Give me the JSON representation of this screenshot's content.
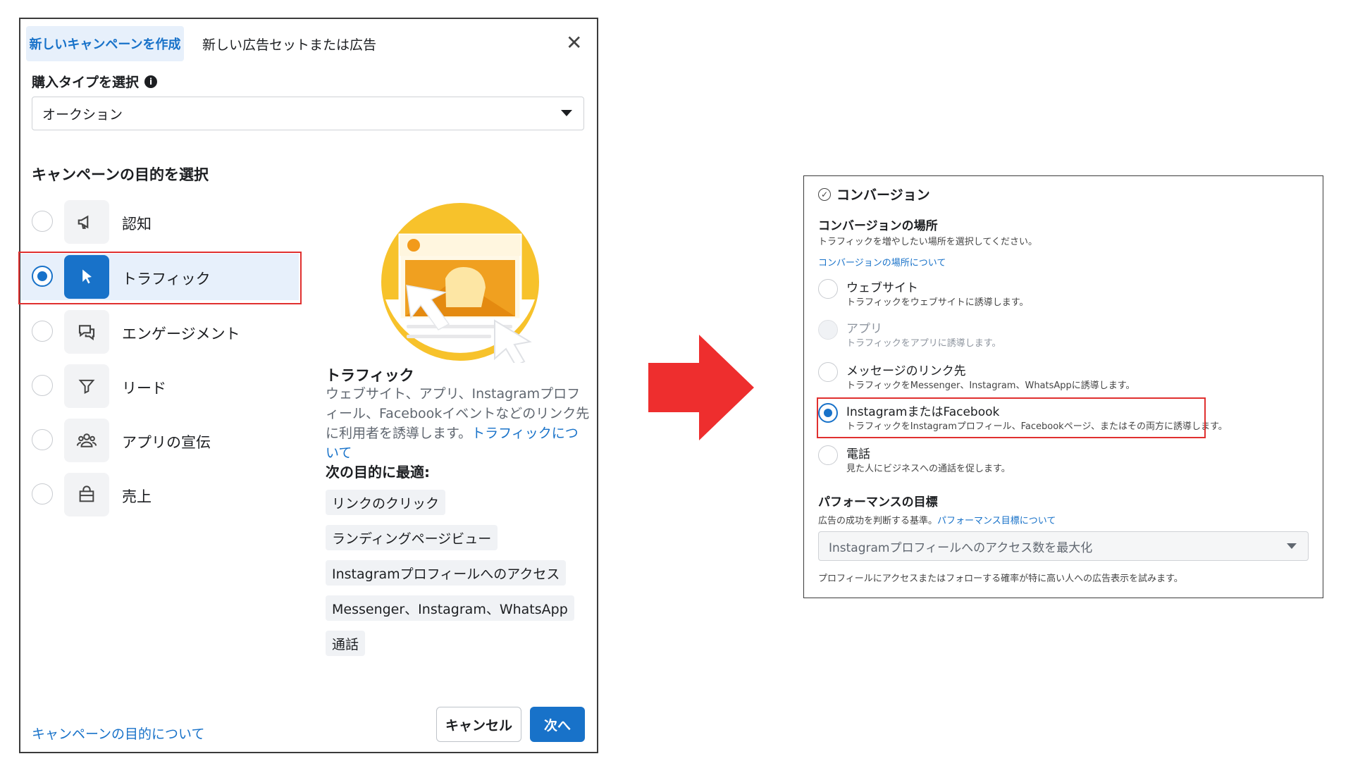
{
  "dialog": {
    "tabs": [
      "新しいキャンペーンを作成",
      "新しい広告セットまたは広告"
    ],
    "buy_type_label": "購入タイプを選択",
    "buy_type_value": "オークション",
    "objective_label": "キャンペーンの目的を選択",
    "objectives": [
      {
        "label": "認知",
        "icon": "megaphone-icon"
      },
      {
        "label": "トラフィック",
        "icon": "cursor-icon",
        "selected": true
      },
      {
        "label": "エンゲージメント",
        "icon": "chat-bubble-icon"
      },
      {
        "label": "リード",
        "icon": "funnel-icon"
      },
      {
        "label": "アプリの宣伝",
        "icon": "people-icon"
      },
      {
        "label": "売上",
        "icon": "shopping-bag-icon"
      }
    ],
    "description": {
      "title": "トラフィック",
      "text": "ウェブサイト、アプリ、Instagramプロフィール、Facebookイベントなどのリンク先に利用者を誘導します。",
      "link": "トラフィックについて"
    },
    "best_for_title": "次の目的に最適:",
    "best_for": [
      "リンクのクリック",
      "ランディングページビュー",
      "Instagramプロフィールへのアクセス",
      "Messenger、Instagram、WhatsApp",
      "通話"
    ],
    "footer_link": "キャンペーンの目的について",
    "cancel": "キャンセル",
    "next": "次へ"
  },
  "panel": {
    "header": "コンバージョン",
    "location_title": "コンバージョンの場所",
    "location_desc": "トラフィックを増やしたい場所を選択してください。",
    "location_link": "コンバージョンの場所について",
    "options": [
      {
        "title": "ウェブサイト",
        "desc": "トラフィックをウェブサイトに誘導します。",
        "state": "enabled"
      },
      {
        "title": "アプリ",
        "desc": "トラフィックをアプリに誘導します。",
        "state": "disabled"
      },
      {
        "title": "メッセージのリンク先",
        "desc": "トラフィックをMessenger、Instagram、WhatsAppに誘導します。",
        "state": "enabled"
      },
      {
        "title": "InstagramまたはFacebook",
        "desc": "トラフィックをInstagramプロフィール、Facebookページ、またはその両方に誘導します。",
        "state": "selected"
      },
      {
        "title": "電話",
        "desc": "見た人にビジネスへの通話を促します。",
        "state": "enabled"
      }
    ],
    "perf_title": "パフォーマンスの目標",
    "perf_desc": "広告の成功を判断する基準。",
    "perf_link": "パフォーマンス目標について",
    "perf_select": "Instagramプロフィールへのアクセス数を最大化",
    "perf_note": "プロフィールにアクセスまたはフォローする確率が特に高い人への広告表示を試みます。"
  },
  "colors": {
    "accent": "#1872c9",
    "highlight_border": "#e0302f",
    "arrow": "#ee2e2e"
  }
}
